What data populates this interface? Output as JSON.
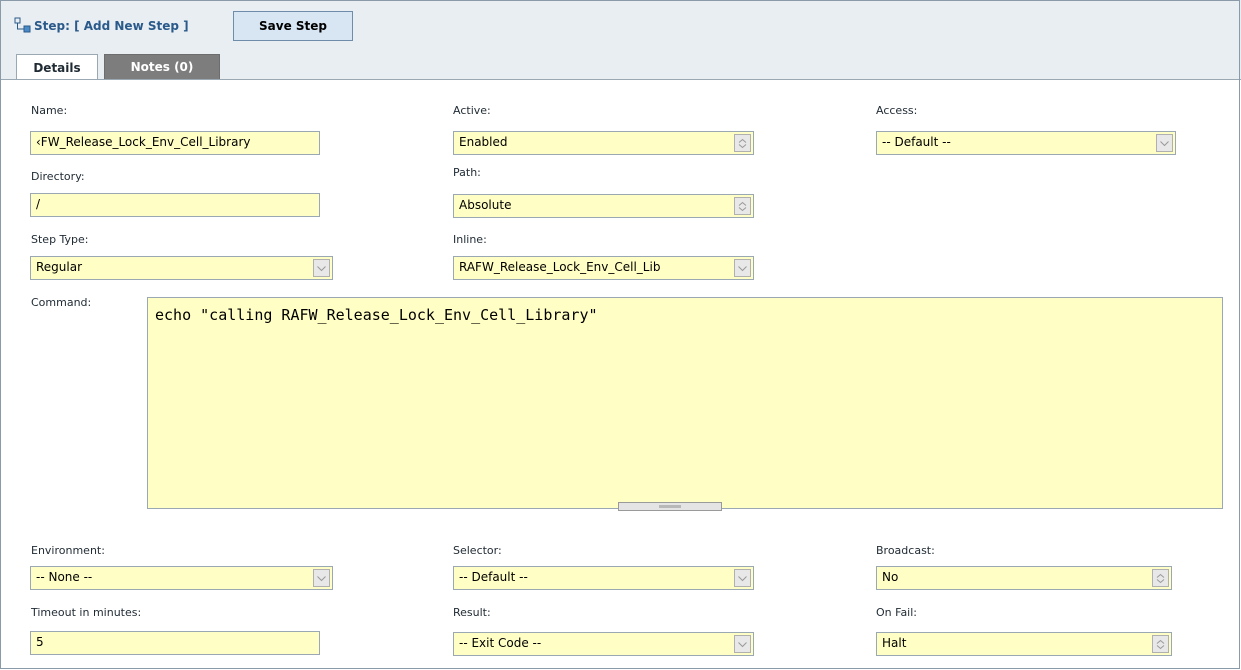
{
  "header": {
    "title": "Step: [ Add New Step ]",
    "save_label": "Save Step"
  },
  "tabs": {
    "details": "Details",
    "notes": "Notes (0)"
  },
  "form": {
    "name": {
      "label": "Name:",
      "value": "‹FW_Release_Lock_Env_Cell_Library"
    },
    "active": {
      "label": "Active:",
      "value": "Enabled"
    },
    "access": {
      "label": "Access:",
      "value": "-- Default --"
    },
    "directory": {
      "label": "Directory:",
      "value": "/"
    },
    "path": {
      "label": "Path:",
      "value": "Absolute"
    },
    "step_type": {
      "label": "Step Type:",
      "value": "Regular"
    },
    "inline": {
      "label": "Inline:",
      "value": "RAFW_Release_Lock_Env_Cell_Lib"
    },
    "command": {
      "label": "Command:",
      "value": "echo \"calling RAFW_Release_Lock_Env_Cell_Library\""
    },
    "environment": {
      "label": "Environment:",
      "value": "-- None --"
    },
    "selector": {
      "label": "Selector:",
      "value": "-- Default --"
    },
    "broadcast": {
      "label": "Broadcast:",
      "value": "No"
    },
    "timeout": {
      "label": "Timeout in minutes:",
      "value": "5"
    },
    "result": {
      "label": "Result:",
      "value": "-- Exit Code --"
    },
    "on_fail": {
      "label": "On Fail:",
      "value": "Halt"
    }
  },
  "colors": {
    "field_bg": "#ffffc5",
    "header_bg": "#e9eef3",
    "link": "#2a5a8a"
  }
}
